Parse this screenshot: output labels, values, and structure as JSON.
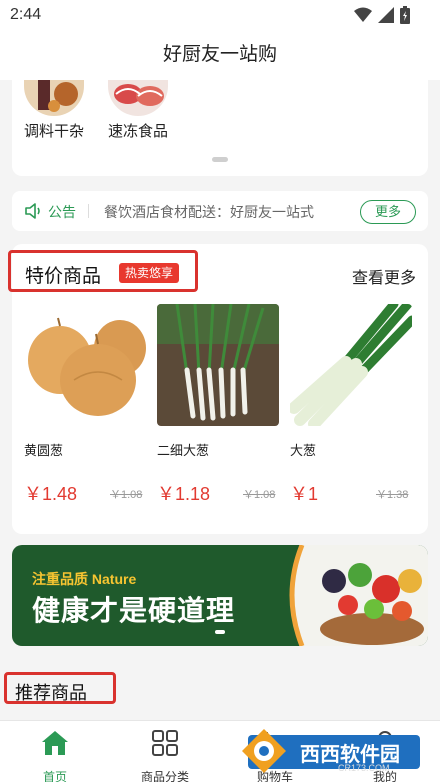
{
  "status_bar": {
    "time": "2:44"
  },
  "header": {
    "title": "好厨友一站购"
  },
  "categories": [
    {
      "label": "调料干杂"
    },
    {
      "label": "速冻食品"
    }
  ],
  "notice": {
    "tag": "公告",
    "text": "餐饮酒店食材配送：好厨友一站式",
    "more_label": "更多"
  },
  "special": {
    "title": "特价商品",
    "badge": "热卖悠享",
    "see_more": "查看更多",
    "products": [
      {
        "name": "黄圆葱",
        "price": "￥1.48",
        "old_price": "￥1.08"
      },
      {
        "name": "二细大葱",
        "price": "￥1.18",
        "old_price": "￥1.08"
      },
      {
        "name": "大葱",
        "price": "￥1",
        "old_price": "￥1.38"
      }
    ]
  },
  "banner": {
    "subtitle": "注重品质 Nature",
    "main": "健康才是硬道理"
  },
  "recommend": {
    "title": "推荐商品"
  },
  "tabs": [
    {
      "label": "首页",
      "icon": "home-icon"
    },
    {
      "label": "商品分类",
      "icon": "grid-icon"
    },
    {
      "label": "购物车",
      "icon": "cart-icon"
    },
    {
      "label": "我的",
      "icon": "user-icon"
    }
  ],
  "watermark": {
    "name": "西西软件园",
    "url": "CR173.COM"
  },
  "colors": {
    "brand_green": "#2b9a55",
    "price_red": "#e23a31",
    "highlight_red": "#d9322e"
  }
}
